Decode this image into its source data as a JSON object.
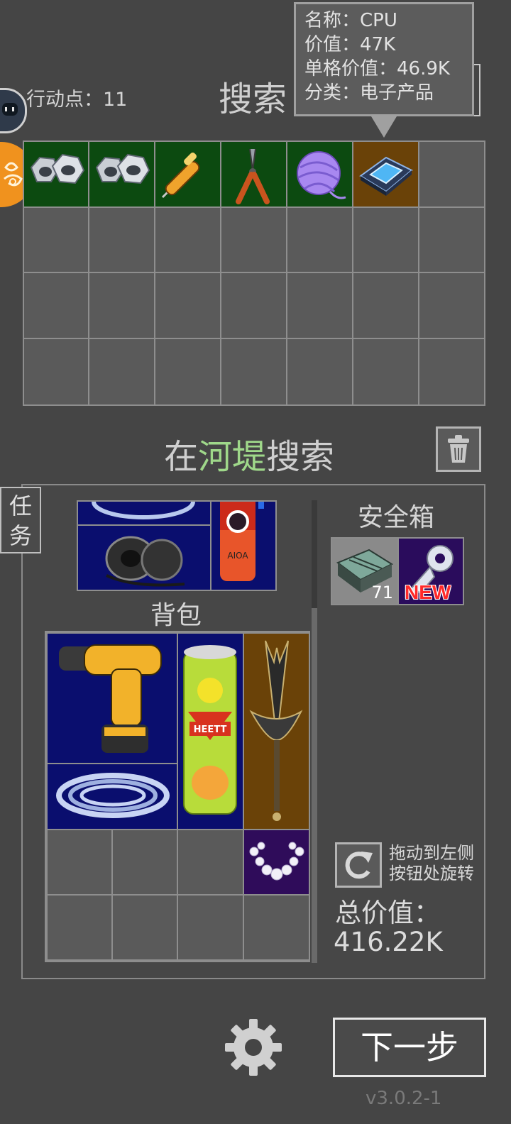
{
  "header": {
    "action_points_label": "行动点：11",
    "search_title": "搜索"
  },
  "tooltip": {
    "name_line": "名称：CPU",
    "value_line": "价值：47K",
    "unit_value_line": "单格价值：46.9K",
    "category_line": "分类：电子产品"
  },
  "search_grid": {
    "columns": 7,
    "rows": 4,
    "items": [
      {
        "name": "hex-nut",
        "bg": "#0c4a10"
      },
      {
        "name": "hex-nut",
        "bg": "#0c4a10"
      },
      {
        "name": "voltage-tester-screwdriver",
        "bg": "#0c4a10"
      },
      {
        "name": "pliers",
        "bg": "#0c4a10"
      },
      {
        "name": "yarn-ball",
        "bg": "#0c4a10"
      },
      {
        "name": "cpu-chip",
        "bg": "#6a4208"
      }
    ]
  },
  "location": {
    "prefix": "在",
    "place": "河堤",
    "suffix": "搜索",
    "place_color": "#9fd88a"
  },
  "task_tab": {
    "line1": "任",
    "line2": "务"
  },
  "backpack": {
    "title": "背包",
    "items": [
      "cordless-drill",
      "vitamin-tube",
      "dagger",
      "coiled-hose",
      "pearl-necklace"
    ]
  },
  "upper_container": {
    "items": [
      "coiled-hose",
      "can",
      "speaker-cable"
    ]
  },
  "safe_box": {
    "title": "安全箱",
    "items": [
      {
        "name": "battery-block",
        "count": "71"
      },
      {
        "name": "key",
        "badge": "NEW"
      }
    ]
  },
  "rotate_hint": {
    "line1": "拖动到左侧",
    "line2": "按钮处旋转"
  },
  "total_value": {
    "label": "总价值：",
    "value": "416.22K"
  },
  "next_button": {
    "label": "下一步"
  },
  "version": "v3.0.2-1",
  "colors": {
    "background": "#454545",
    "cell": "#5a5a5a",
    "item_green": "#0c4a10",
    "item_brown": "#6a4208",
    "item_navy": "#0a0e6e",
    "item_purple": "#2f0c5a",
    "orange_badge": "#f0921e"
  },
  "icons": [
    "avatar-icon",
    "skill-badge-icon",
    "trash-icon",
    "rotate-icon",
    "gear-icon"
  ]
}
